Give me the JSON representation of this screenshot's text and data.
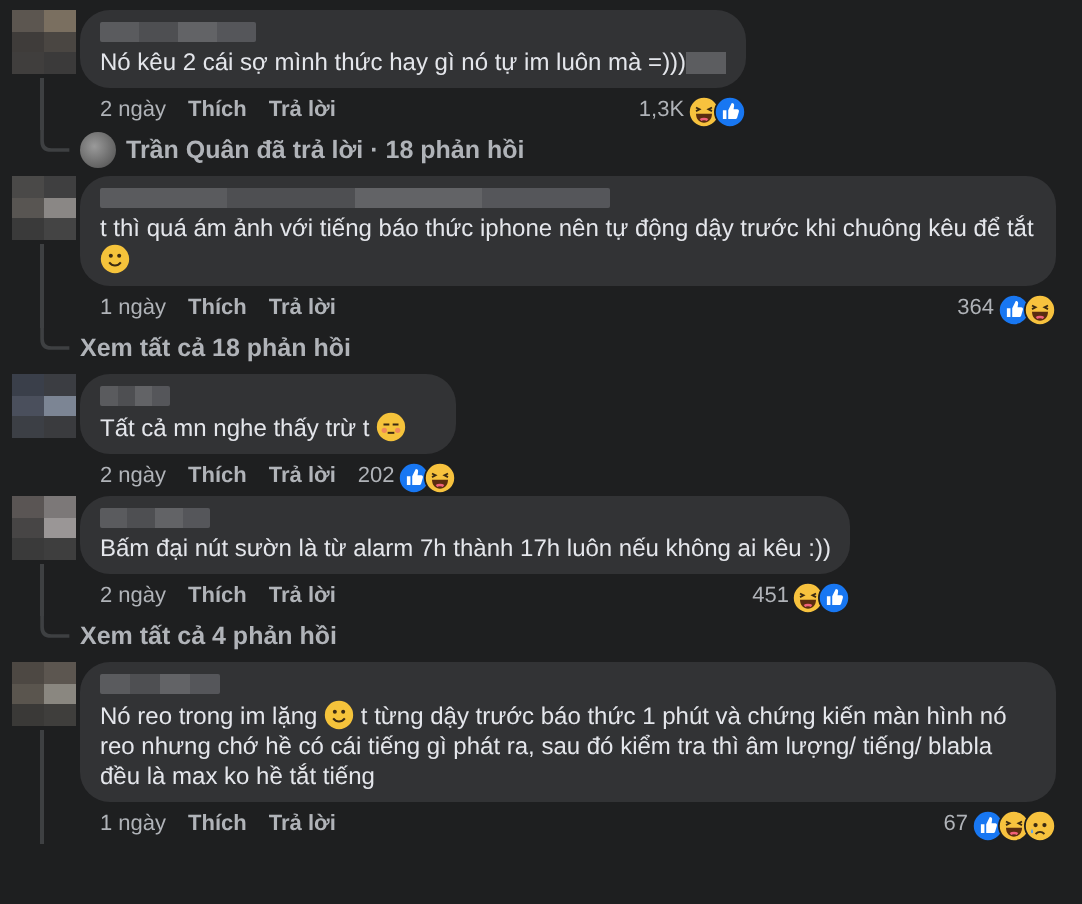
{
  "thread": [
    {
      "kind": "comment",
      "has_line": true,
      "parts": [
        {
          "kind": "text",
          "text": "Nó kêu 2 cái sợ mình thức hay gì nó tự im luôn mà =)))"
        },
        {
          "kind": "redacted"
        }
      ],
      "time": "2 ngày",
      "like_label": "Thích",
      "reply_label": "Trả lời",
      "reaction_count": "1,3K",
      "reactions": [
        {
          "kind": "haha"
        },
        {
          "kind": "like"
        }
      ]
    },
    {
      "kind": "reply_summary",
      "text": "Trần Quân đã trả lời · 18 phản hồi"
    },
    {
      "kind": "comment",
      "has_line": true,
      "parts": [
        {
          "kind": "text",
          "text": "t thì quá ám ảnh với tiếng báo thức iphone nên tự động dậy trước khi chuông kêu để tắt "
        },
        {
          "kind": "smile_emoji"
        }
      ],
      "time": "1 ngày",
      "like_label": "Thích",
      "reply_label": "Trả lời",
      "reaction_count": "364",
      "reactions": [
        {
          "kind": "like"
        },
        {
          "kind": "haha"
        }
      ]
    },
    {
      "kind": "replies_link",
      "text": "Xem tất cả 18 phản hồi"
    },
    {
      "kind": "comment",
      "has_line": false,
      "parts": [
        {
          "kind": "text",
          "text": "Tất cả mn nghe thấy trừ t "
        },
        {
          "kind": "flushed_emoji"
        }
      ],
      "time": "2 ngày",
      "like_label": "Thích",
      "reply_label": "Trả lời",
      "reaction_count": "202",
      "reactions": [
        {
          "kind": "like"
        },
        {
          "kind": "haha"
        }
      ]
    },
    {
      "kind": "comment",
      "has_line": true,
      "parts": [
        {
          "kind": "text",
          "text": "Bấm đại nút sườn là từ alarm 7h thành 17h luôn nếu không ai kêu :))"
        }
      ],
      "time": "2 ngày",
      "like_label": "Thích",
      "reply_label": "Trả lời",
      "reaction_count": "451",
      "reactions": [
        {
          "kind": "haha"
        },
        {
          "kind": "like"
        }
      ]
    },
    {
      "kind": "replies_link",
      "text": "Xem tất cả 4 phản hồi"
    },
    {
      "kind": "comment",
      "has_line": true,
      "parts": [
        {
          "kind": "text",
          "text": "Nó reo trong im lặng "
        },
        {
          "kind": "smile_emoji"
        },
        {
          "kind": "text",
          "text": " t từng dậy trước báo thức 1 phút và chứng kiến màn hình nó reo nhưng chớ hề có cái tiếng gì phát ra, sau đó kiểm tra thì âm lượng/ tiếng/ blabla đều là max ko hề tắt tiếng"
        }
      ],
      "time": "1 ngày",
      "like_label": "Thích",
      "reply_label": "Trả lời",
      "reaction_count": "67",
      "reactions": [
        {
          "kind": "like"
        },
        {
          "kind": "haha"
        },
        {
          "kind": "sad"
        }
      ]
    }
  ]
}
